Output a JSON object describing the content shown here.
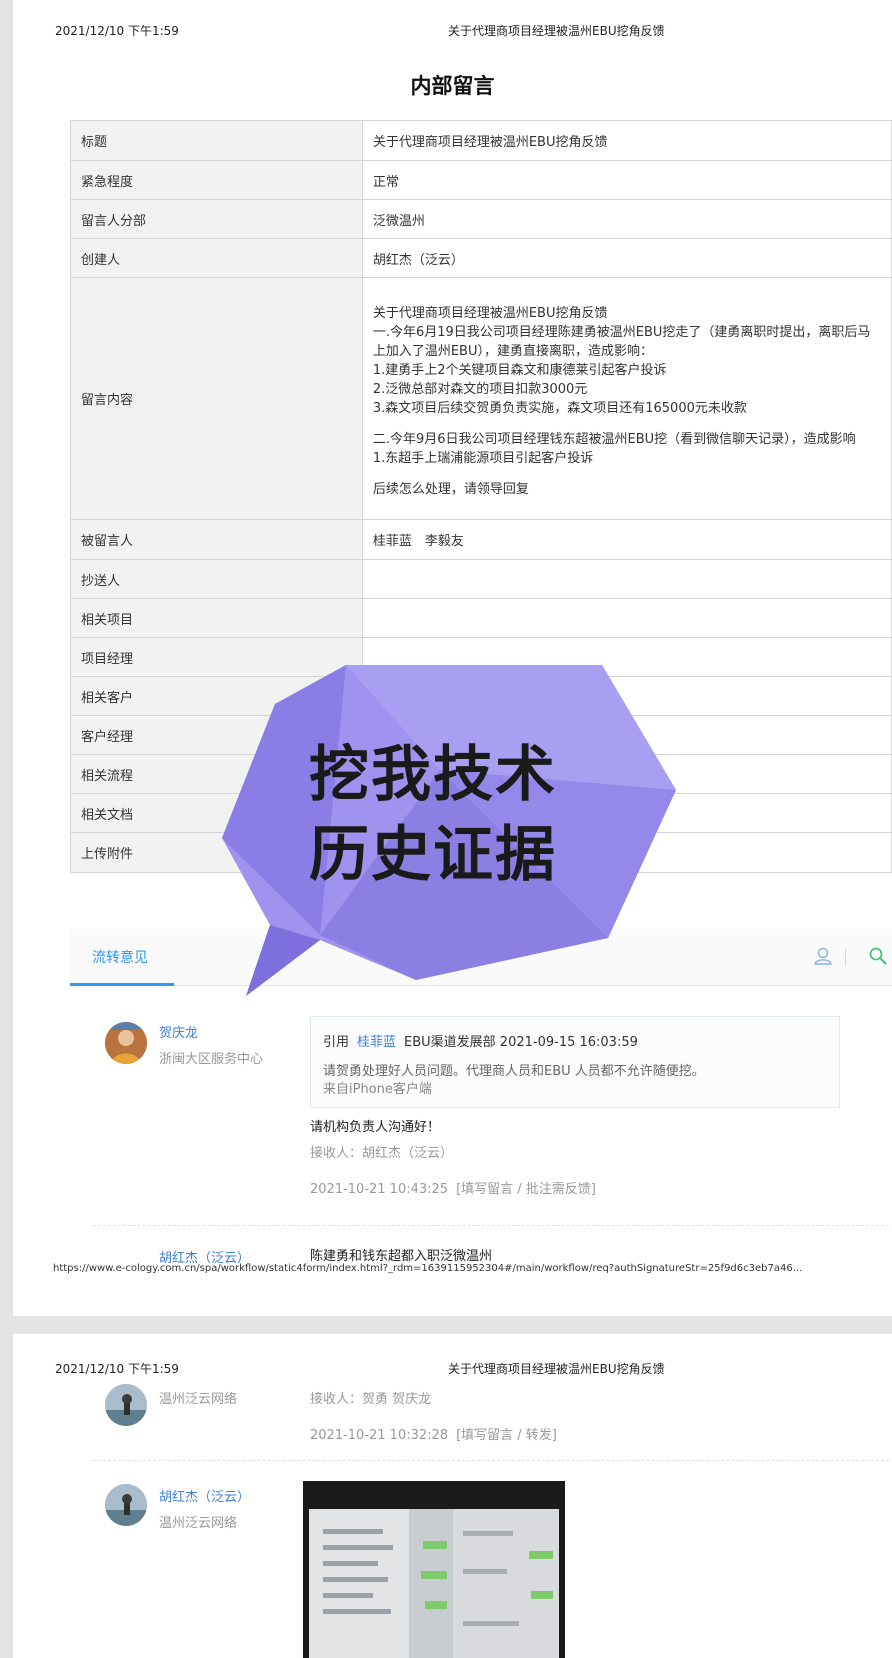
{
  "page1": {
    "header_date": "2021/12/10 下午1:59",
    "header_title": "关于代理商项目经理被温州EBU挖角反馈",
    "doc_title": "内部留言",
    "form": {
      "rows": [
        {
          "label": "标题",
          "value": "关于代理商项目经理被温州EBU挖角反馈"
        },
        {
          "label": "紧急程度",
          "value": "正常"
        },
        {
          "label": "留言人分部",
          "value": "泛微温州"
        },
        {
          "label": "创建人",
          "value": "胡红杰（泛云）"
        }
      ],
      "content_label": "留言内容",
      "content_lines": [
        "关于代理商项目经理被温州EBU挖角反馈",
        "一.今年6月19日我公司项目经理陈建勇被温州EBU挖走了（建勇离职时提出，离职后马上加入了温州EBU），建勇直接离职，造成影响：",
        "1.建勇手上2个关键项目森文和康德莱引起客户投诉",
        "2.泛微总部对森文的项目扣款3000元",
        "3.森文项目后续交贺勇负责实施，森文项目还有165000元未收款"
      ],
      "content_lines_2": [
        "二.今年9月6日我公司项目经理钱东超被温州EBU挖（看到微信聊天记录），造成影响",
        "1.东超手上瑞浦能源项目引起客户投诉"
      ],
      "content_lines_3": [
        "后续怎么处理，请领导回复"
      ],
      "rows2": [
        {
          "label": "被留言人",
          "value": "桂菲蓝　李毅友"
        },
        {
          "label": "抄送人",
          "value": ""
        },
        {
          "label": "相关项目",
          "value": ""
        },
        {
          "label": "项目经理",
          "value": ""
        },
        {
          "label": "相关客户",
          "value": ""
        },
        {
          "label": "客户经理",
          "value": ""
        },
        {
          "label": "相关流程",
          "value": ""
        },
        {
          "label": "相关文档",
          "value": ""
        },
        {
          "label": "上传附件",
          "value": ""
        }
      ]
    },
    "tab_label": "流转意见",
    "comment1": {
      "name": "贺庆龙",
      "dept": "浙闽大区服务中心",
      "quote_prefix": "引用",
      "quote_name": "桂菲蓝",
      "quote_meta": "EBU渠道发展部 2021-09-15 16:03:59",
      "quote_text": "请贺勇处理好人员问题。代理商人员和EBU 人员都不允许随便挖。",
      "quote_source": "来自iPhone客户端",
      "text": "请机构负责人沟通好！",
      "receiver": "接收人：胡红杰（泛云）",
      "time": "2021-10-21 10:43:25",
      "actions": "[填写留言 / 批注需反馈]"
    },
    "comment2": {
      "name": "胡红杰（泛云）",
      "text": "陈建勇和钱东超都入职泛微温州"
    },
    "url": "https://www.e-cology.com.cn/spa/workflow/static4form/index.html?_rdm=1639115952304#/main/workflow/req?authSignatureStr=25f9d6c3eb7a46..."
  },
  "page2": {
    "header_date": "2021/12/10 下午1:59",
    "header_title": "关于代理商项目经理被温州EBU挖角反馈",
    "comment_a": {
      "dept": "温州泛云网络",
      "receiver": "接收人：贺勇 贺庆龙",
      "time": "2021-10-21 10:32:28",
      "actions": "[填写留言 / 转发]"
    },
    "comment_b": {
      "name": "胡红杰（泛云）",
      "dept": "温州泛云网络"
    }
  },
  "overlay": {
    "line1": "挖我技术",
    "line2": "历史证据",
    "color": "#9f93ef"
  },
  "colors": {
    "accent": "#2b9af3",
    "name_link": "#3d7fd6"
  }
}
